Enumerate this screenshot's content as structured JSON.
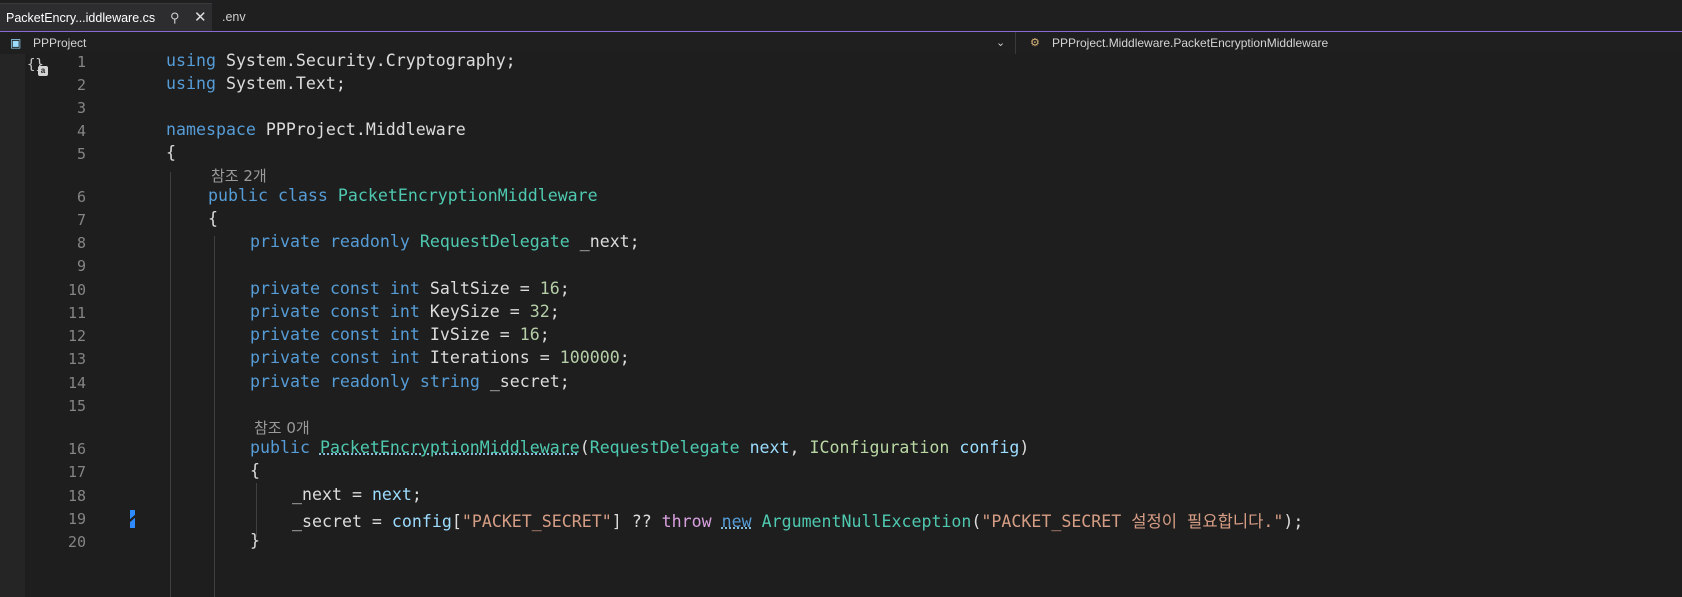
{
  "tabs": {
    "active_label": "PacketEncry...iddleware.cs",
    "pin_glyph": "⚲",
    "close_glyph": "✕",
    "second_label": ".env"
  },
  "navbar": {
    "project": "PPProject",
    "project_chevron": "⌄",
    "member": "PPProject.Middleware.PacketEncryptionMiddleware"
  },
  "editor": {
    "scope_glyph": "{}",
    "scope_badge": "a",
    "lines": [
      {
        "num": "1"
      },
      {
        "num": "2"
      },
      {
        "num": "3"
      },
      {
        "num": "4"
      },
      {
        "num": "5"
      },
      {
        "num": "6"
      },
      {
        "num": "7"
      },
      {
        "num": "8"
      },
      {
        "num": "9"
      },
      {
        "num": "10"
      },
      {
        "num": "11"
      },
      {
        "num": "12"
      },
      {
        "num": "13"
      },
      {
        "num": "14"
      },
      {
        "num": "15"
      },
      {
        "num": "16"
      },
      {
        "num": "17"
      },
      {
        "num": "18"
      },
      {
        "num": "19"
      },
      {
        "num": "20"
      }
    ],
    "codelens_class": "참조 2개",
    "codelens_ctor": "참조 0개",
    "tokens": {
      "using": "using",
      "ns1": "System.Security.Cryptography;",
      "ns2": "System.Text;",
      "namespace": "namespace",
      "ns_name": "PPProject.Middleware",
      "open_brace": "{",
      "close_brace": "}",
      "public": "public",
      "class": "class",
      "class_name": "PacketEncryptionMiddleware",
      "private": "private",
      "readonly": "readonly",
      "const": "const",
      "int": "int",
      "string": "string",
      "request_delegate": "RequestDelegate",
      "next_field": " _next;",
      "salt": " SaltSize = ",
      "salt_val": "16",
      "key": " KeySize = ",
      "key_val": "32",
      "iv": " IvSize = ",
      "iv_val": "16",
      "iter": " Iterations = ",
      "iter_val": "100000",
      "semicolon": ";",
      "secret_field": " _secret;",
      "ctor_name": "PacketEncryptionMiddleware",
      "paren_open": "(",
      "next_param": "next",
      "comma": ", ",
      "iconfiguration": "IConfiguration",
      "config_param": "config",
      "paren_close": ")",
      "assign_next_lhs": "_next = ",
      "assign_next_rhs": "next",
      "assign_secret_lhs": "_secret = ",
      "config_ref": "config",
      "index_open": "[",
      "packet_secret_str": "\"PACKET_SECRET\"",
      "index_close": "] ?? ",
      "throw": "throw",
      "new": "new",
      "ane": "ArgumentNullException",
      "err_str": "\"PACKET_SECRET 설정이 필요합니다.\"",
      "end_call": ");"
    }
  },
  "colors": {
    "keyword": "#569cd6",
    "control_keyword": "#d8a0df",
    "type": "#4ec9b0",
    "string": "#d69d85",
    "number": "#b5cea8",
    "parameter": "#9cdcfe",
    "accent_border": "#8a6bd4",
    "change_marker": "#2e8bff"
  }
}
